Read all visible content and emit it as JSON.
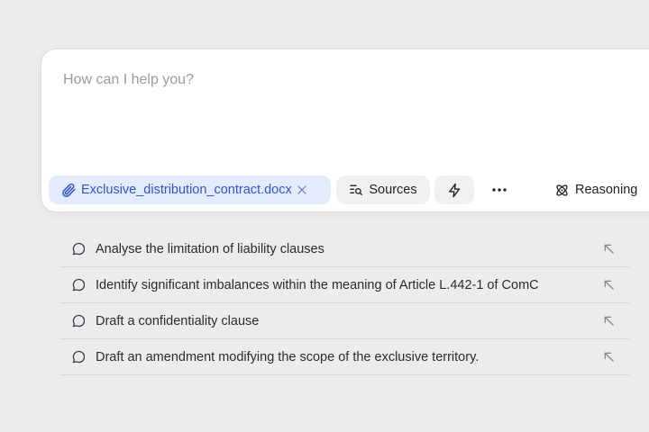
{
  "composer": {
    "placeholder": "How can I help you?",
    "attachment": {
      "filename": "Exclusive_distribution_contract.docx",
      "icon": "paperclip-icon",
      "remove_icon": "close-icon"
    },
    "sources_label": "Sources",
    "reasoning_label": "Reasoning",
    "accent_color": "#2e55c8"
  },
  "suggestions": [
    {
      "label": "Analyse the limitation of liability clauses"
    },
    {
      "label": "Identify significant imbalances within the meaning of Article L.442-1 of ComC"
    },
    {
      "label": "Draft a confidentiality clause"
    },
    {
      "label": "Draft an amendment modifying the scope of the exclusive territory."
    }
  ]
}
